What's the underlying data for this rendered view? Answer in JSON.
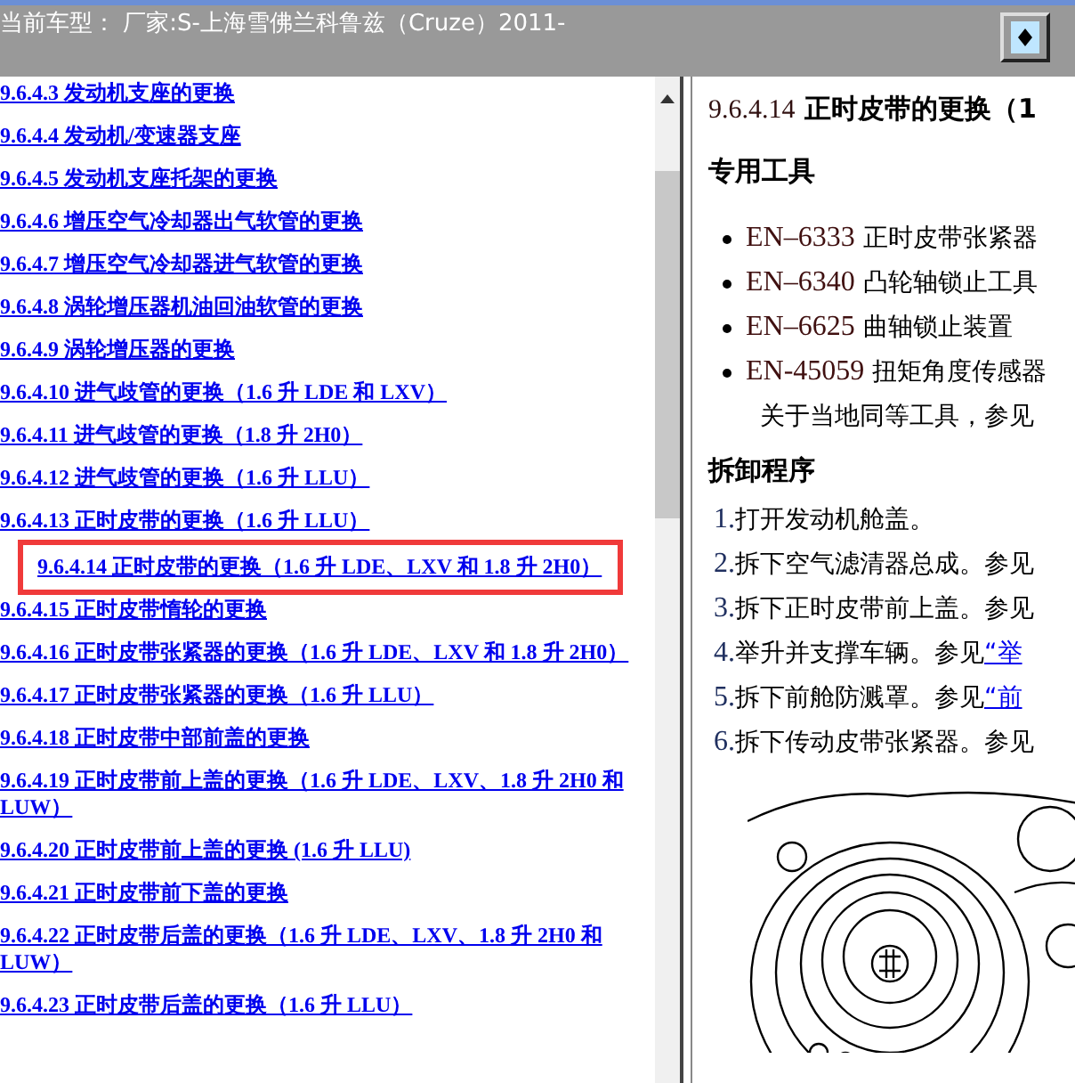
{
  "header": {
    "title": "当前车型： 厂家:S-上海雪佛兰科鲁兹（Cruze）2011-"
  },
  "toc": {
    "items": [
      {
        "text": "9.6.4.3 发动机支座的更换",
        "highlighted": false
      },
      {
        "text": "9.6.4.4 发动机/变速器支座",
        "highlighted": false
      },
      {
        "text": "9.6.4.5 发动机支座托架的更换",
        "highlighted": false
      },
      {
        "text": "9.6.4.6 增压空气冷却器出气软管的更换",
        "highlighted": false
      },
      {
        "text": "9.6.4.7 增压空气冷却器进气软管的更换",
        "highlighted": false
      },
      {
        "text": "9.6.4.8 涡轮增压器机油回油软管的更换",
        "highlighted": false
      },
      {
        "text": "9.6.4.9 涡轮增压器的更换",
        "highlighted": false
      },
      {
        "text": "9.6.4.10 进气歧管的更换（1.6 升 LDE 和 LXV）",
        "highlighted": false
      },
      {
        "text": "9.6.4.11 进气歧管的更换（1.8 升 2H0）",
        "highlighted": false
      },
      {
        "text": "9.6.4.12 进气歧管的更换（1.6 升 LLU）",
        "highlighted": false
      },
      {
        "text": "9.6.4.13 正时皮带的更换（1.6 升 LLU）",
        "highlighted": false
      },
      {
        "text": "9.6.4.14 正时皮带的更换（1.6 升 LDE、LXV 和 1.8 升 2H0）",
        "highlighted": true
      },
      {
        "text": "9.6.4.15 正时皮带惰轮的更换",
        "highlighted": false
      },
      {
        "text": "9.6.4.16 正时皮带张紧器的更换（1.6 升 LDE、LXV 和 1.8 升 2H0）",
        "highlighted": false
      },
      {
        "text": "9.6.4.17 正时皮带张紧器的更换（1.6 升 LLU）",
        "highlighted": false
      },
      {
        "text": "9.6.4.18 正时皮带中部前盖的更换",
        "highlighted": false
      },
      {
        "text": "9.6.4.19 正时皮带前上盖的更换（1.6 升 LDE、LXV、1.8 升 2H0 和 LUW）",
        "highlighted": false
      },
      {
        "text": "9.6.4.20 正时皮带前上盖的更换 (1.6 升 LLU)",
        "highlighted": false
      },
      {
        "text": "9.6.4.21 正时皮带前下盖的更换",
        "highlighted": false
      },
      {
        "text": "9.6.4.22 正时皮带后盖的更换（1.6 升 LDE、LXV、1.8 升 2H0 和 LUW）",
        "highlighted": false
      },
      {
        "text": "9.6.4.23 正时皮带后盖的更换（1.6 升 LLU）",
        "highlighted": false
      }
    ]
  },
  "article": {
    "title_number": "9.6.4.14",
    "title": "正时皮带的更换（1",
    "tools_heading": "专用工具",
    "tools": [
      {
        "code": "EN–6333",
        "text": "正时皮带张紧器"
      },
      {
        "code": "EN–6340",
        "text": "凸轮轴锁止工具"
      },
      {
        "code": "EN–6625",
        "text": "曲轴锁止装置"
      },
      {
        "code": "EN-45059",
        "text": "扭矩角度传感器"
      }
    ],
    "tools_note": "关于当地同等工具，参见",
    "procedure_heading": "拆卸程序",
    "steps": [
      {
        "number": "1.",
        "text": "打开发动机舱盖。"
      },
      {
        "number": "2.",
        "text": "拆下空气滤清器总成。参见"
      },
      {
        "number": "3.",
        "text": "拆下正时皮带前上盖。参见"
      },
      {
        "number": "4.",
        "text": "举升并支撑车辆。参见",
        "link": "“举"
      },
      {
        "number": "5.",
        "text": "拆下前舱防溅罩。参见",
        "link": "“前"
      },
      {
        "number": "6.",
        "text": "拆下传动皮带张紧器。参见"
      }
    ]
  }
}
